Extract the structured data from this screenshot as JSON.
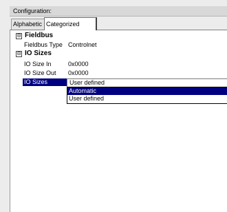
{
  "header": {
    "title": "Configuration:"
  },
  "tabs": [
    {
      "label": "Alphabetic"
    },
    {
      "label": "Categorized"
    }
  ],
  "categories": [
    {
      "toggle": "⊟",
      "name": "Fieldbus",
      "properties": [
        {
          "name": "Fieldbus Type",
          "value": "Controlnet"
        }
      ]
    },
    {
      "toggle": "⊟",
      "name": "IO Sizes",
      "properties": [
        {
          "name": "IO Size In",
          "value": "0x0000"
        },
        {
          "name": "IO Size Out",
          "value": "0x0000"
        },
        {
          "name": "IO Sizes",
          "value": "User defined"
        }
      ]
    }
  ],
  "dropdown": {
    "options": [
      "Automatic",
      "User defined"
    ],
    "highlighted": "Automatic"
  },
  "colors": {
    "background": "#ececec",
    "selection": "#000080"
  }
}
